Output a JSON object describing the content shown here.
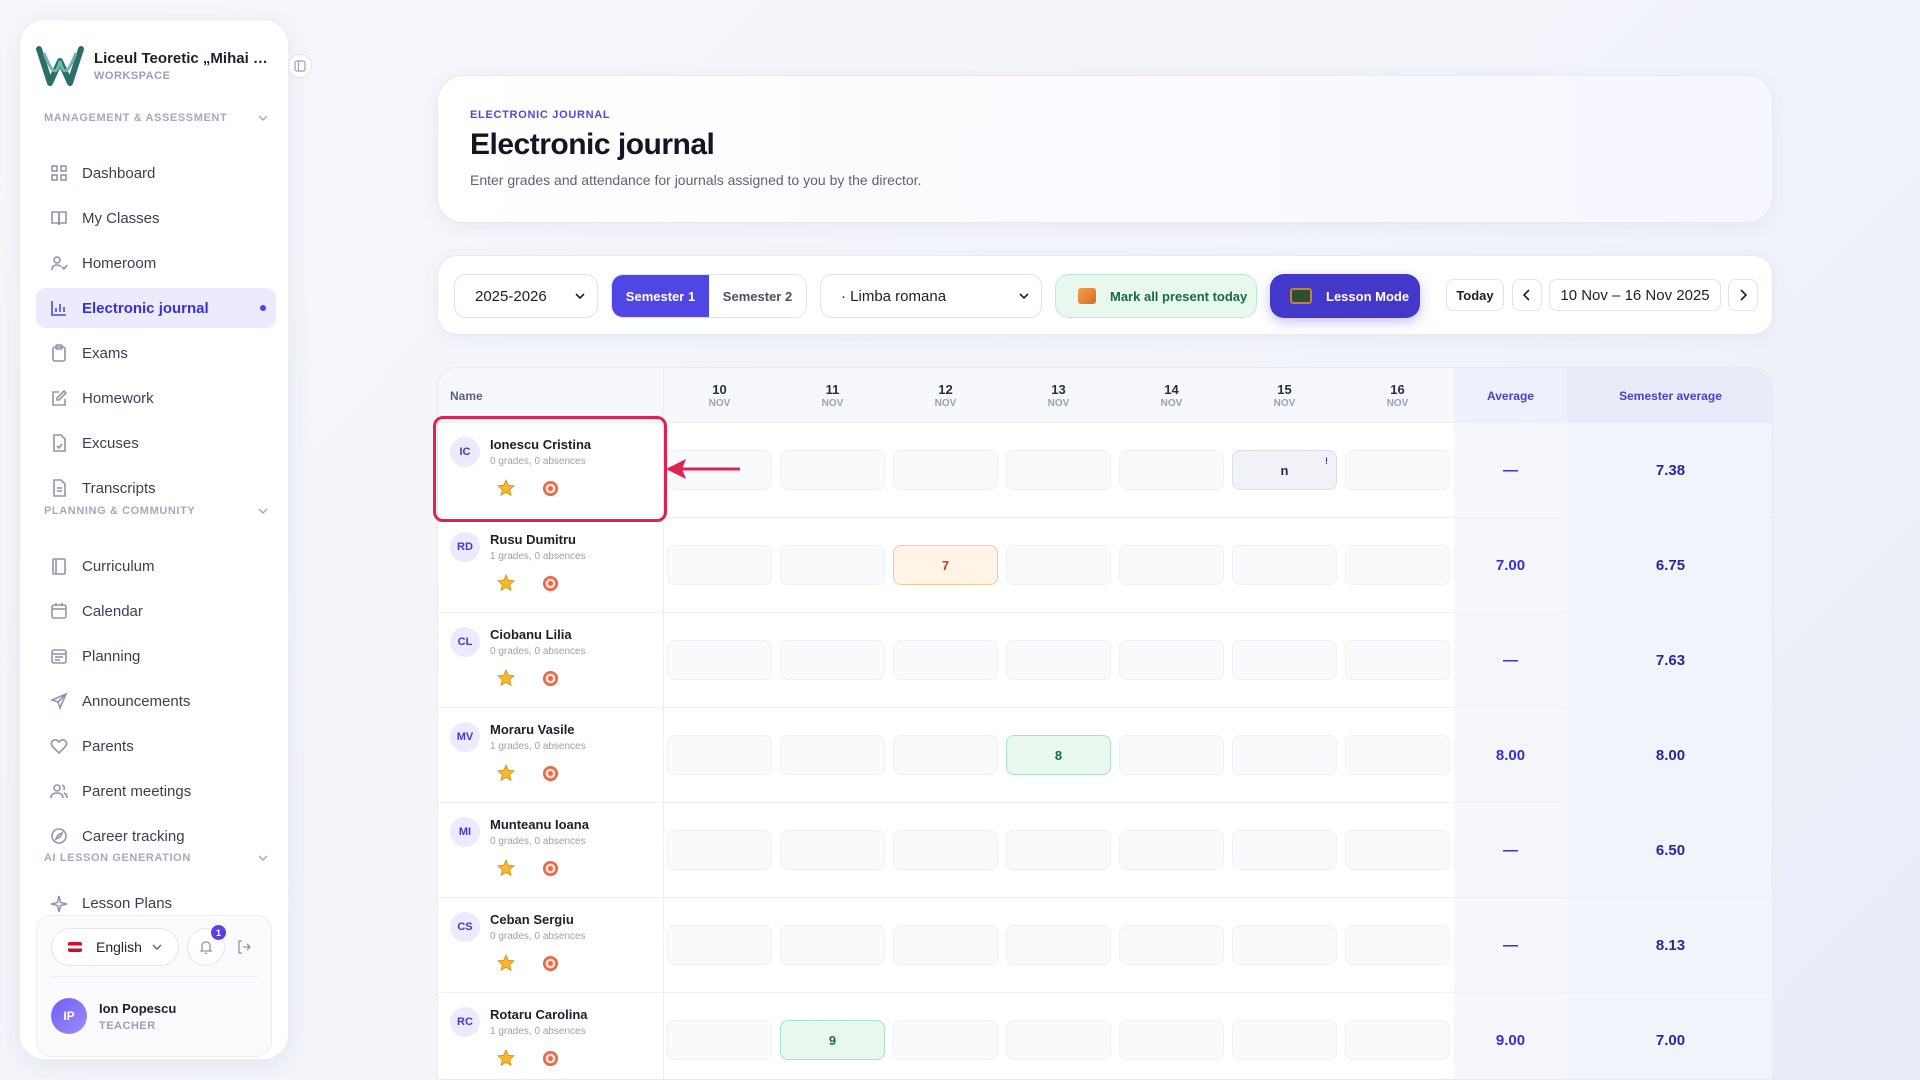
{
  "sidebar": {
    "org_name": "Liceul Teoretic „Mihai Emi...",
    "org_sub": "WORKSPACE",
    "sections": [
      {
        "label": "MANAGEMENT & ASSESSMENT"
      },
      {
        "label": "PLANNING & COMMUNITY"
      },
      {
        "label": "AI LESSON GENERATION"
      }
    ],
    "items": [
      {
        "label": "Dashboard",
        "icon": "grid-icon"
      },
      {
        "label": "My Classes",
        "icon": "book-icon"
      },
      {
        "label": "Homeroom",
        "icon": "user-check-icon"
      },
      {
        "label": "Electronic journal",
        "icon": "bar-chart-icon",
        "active": true
      },
      {
        "label": "Exams",
        "icon": "clipboard-icon"
      },
      {
        "label": "Homework",
        "icon": "edit-icon"
      },
      {
        "label": "Excuses",
        "icon": "file-icon"
      },
      {
        "label": "Transcripts",
        "icon": "file-text-icon"
      },
      {
        "label": "Curriculum",
        "icon": "book-open-icon"
      },
      {
        "label": "Calendar",
        "icon": "calendar-icon"
      },
      {
        "label": "Planning",
        "icon": "calendar-check-icon"
      },
      {
        "label": "Announcements",
        "icon": "send-icon"
      },
      {
        "label": "Parents",
        "icon": "heart-icon"
      },
      {
        "label": "Parent meetings",
        "icon": "users-icon"
      },
      {
        "label": "Career tracking",
        "icon": "compass-icon"
      },
      {
        "label": "Lesson Plans",
        "icon": "sparkle-icon"
      }
    ],
    "language": "English",
    "notifications": "1",
    "user": {
      "initials": "IP",
      "name": "Ion Popescu",
      "role": "TEACHER"
    }
  },
  "header": {
    "kicker": "ELECTRONIC JOURNAL",
    "title": "Electronic journal",
    "subtitle": "Enter grades and attendance for journals assigned to you by the director."
  },
  "toolbar": {
    "year": "2025-2026",
    "semesters": [
      "Semester 1",
      "Semester 2"
    ],
    "active_semester": "Semester 1",
    "subject": "· Limba romana",
    "mark_present_label": "Mark all present today",
    "lesson_mode_label": "Lesson Mode",
    "today_label": "Today",
    "range": "10 Nov – 16 Nov 2025"
  },
  "table": {
    "name_header": "Name",
    "days": [
      {
        "day": "10",
        "month": "NOV"
      },
      {
        "day": "11",
        "month": "NOV"
      },
      {
        "day": "12",
        "month": "NOV"
      },
      {
        "day": "13",
        "month": "NOV"
      },
      {
        "day": "14",
        "month": "NOV"
      },
      {
        "day": "15",
        "month": "NOV"
      },
      {
        "day": "16",
        "month": "NOV"
      }
    ],
    "average_header": "Average",
    "semester_average_header": "Semester average",
    "rows": [
      {
        "initials": "IC",
        "name": "Ionescu Cristina",
        "meta": "0 grades, 0 absences",
        "cells": [
          "",
          "",
          "",
          "",
          "",
          "n",
          ""
        ],
        "average": "—",
        "semester_average": "7.38"
      },
      {
        "initials": "RD",
        "name": "Rusu Dumitru",
        "meta": "1 grades, 0 absences",
        "cells": [
          "",
          "",
          "7",
          "",
          "",
          "",
          ""
        ],
        "average": "7.00",
        "semester_average": "6.75"
      },
      {
        "initials": "CL",
        "name": "Ciobanu Lilia",
        "meta": "0 grades, 0 absences",
        "cells": [
          "",
          "",
          "",
          "",
          "",
          "",
          ""
        ],
        "average": "—",
        "semester_average": "7.63"
      },
      {
        "initials": "MV",
        "name": "Moraru Vasile",
        "meta": "1 grades, 0 absences",
        "cells": [
          "",
          "",
          "",
          "8",
          "",
          "",
          ""
        ],
        "average": "8.00",
        "semester_average": "8.00"
      },
      {
        "initials": "MI",
        "name": "Munteanu Ioana",
        "meta": "0 grades, 0 absences",
        "cells": [
          "",
          "",
          "",
          "",
          "",
          "",
          ""
        ],
        "average": "—",
        "semester_average": "6.50"
      },
      {
        "initials": "CS",
        "name": "Ceban Sergiu",
        "meta": "0 grades, 0 absences",
        "cells": [
          "",
          "",
          "",
          "",
          "",
          "",
          ""
        ],
        "average": "—",
        "semester_average": "8.13"
      },
      {
        "initials": "RC",
        "name": "Rotaru Carolina",
        "meta": "1 grades, 0 absences",
        "cells": [
          "",
          "9",
          "",
          "",
          "",
          "",
          ""
        ],
        "average": "9.00",
        "semester_average": "7.00"
      }
    ]
  },
  "colors": {
    "accent": "#4f46e5",
    "highlight": "#e0234e",
    "present": "#166b43",
    "grade_warn": "#c2410c"
  }
}
